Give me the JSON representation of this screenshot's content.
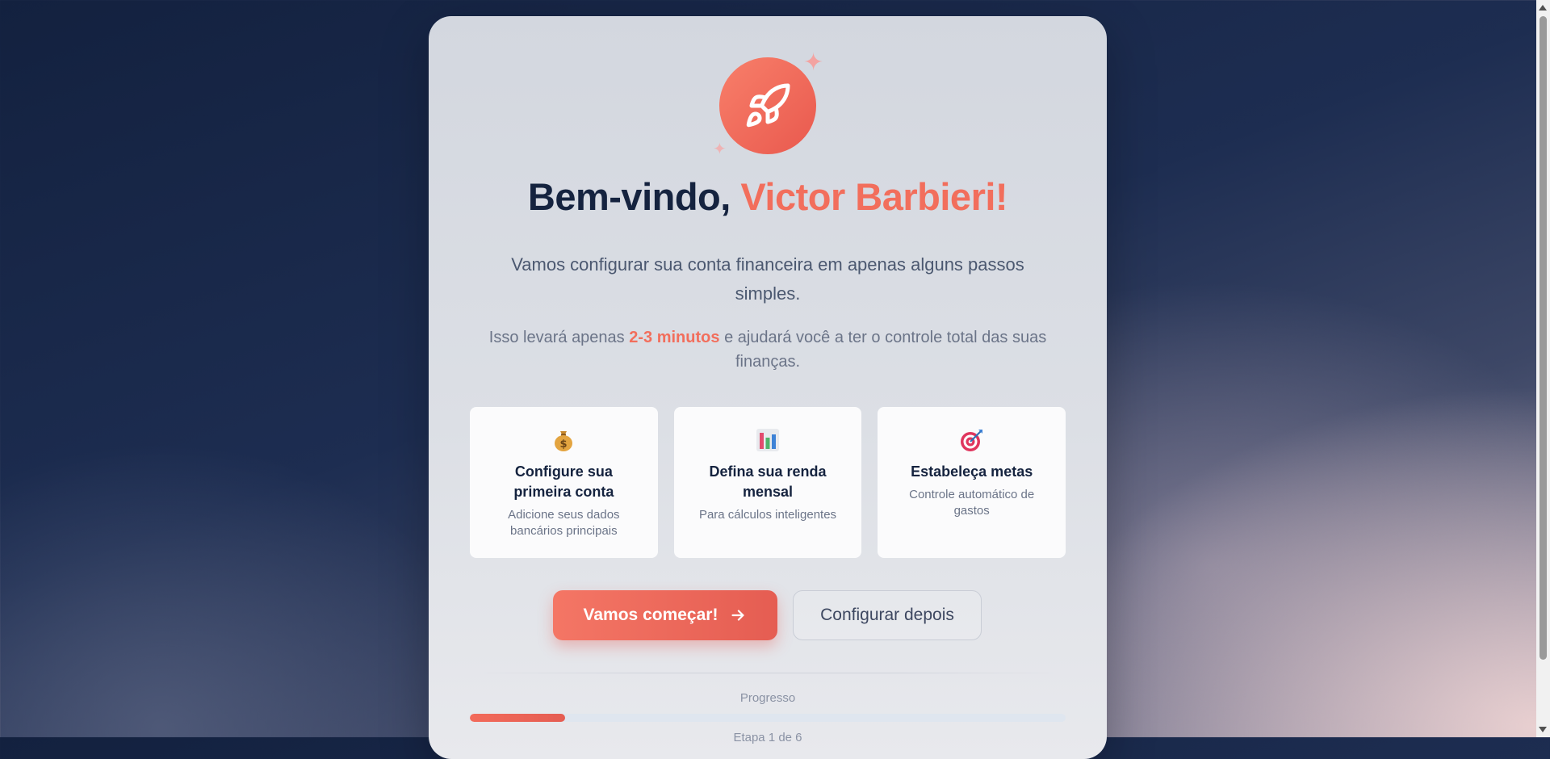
{
  "welcome": {
    "greeting": "Bem-vindo,",
    "user_name": "Victor Barbieri!",
    "subtitle": "Vamos configurar sua conta financeira em apenas alguns passos simples.",
    "time_prefix": "Isso levará apenas",
    "time_highlight": "2-3 minutos",
    "time_suffix": "e ajudará você a ter o controle total das suas finanças.",
    "hero_icon": "rocket-icon"
  },
  "features": [
    {
      "icon": "money-bag-icon",
      "title": "Configure sua primeira conta",
      "description": "Adicione seus dados bancários principais"
    },
    {
      "icon": "bar-chart-icon",
      "title": "Defina sua renda mensal",
      "description": "Para cálculos inteligentes"
    },
    {
      "icon": "target-icon",
      "title": "Estabeleça metas",
      "description": "Controle automático de gastos"
    }
  ],
  "actions": {
    "start_label": "Vamos começar!",
    "later_label": "Configurar depois"
  },
  "progress": {
    "label": "Progresso",
    "step_text": "Etapa 1 de 6",
    "fraction": 0.16
  },
  "colors": {
    "accent": "#f26e5c",
    "title": "#15233f"
  }
}
